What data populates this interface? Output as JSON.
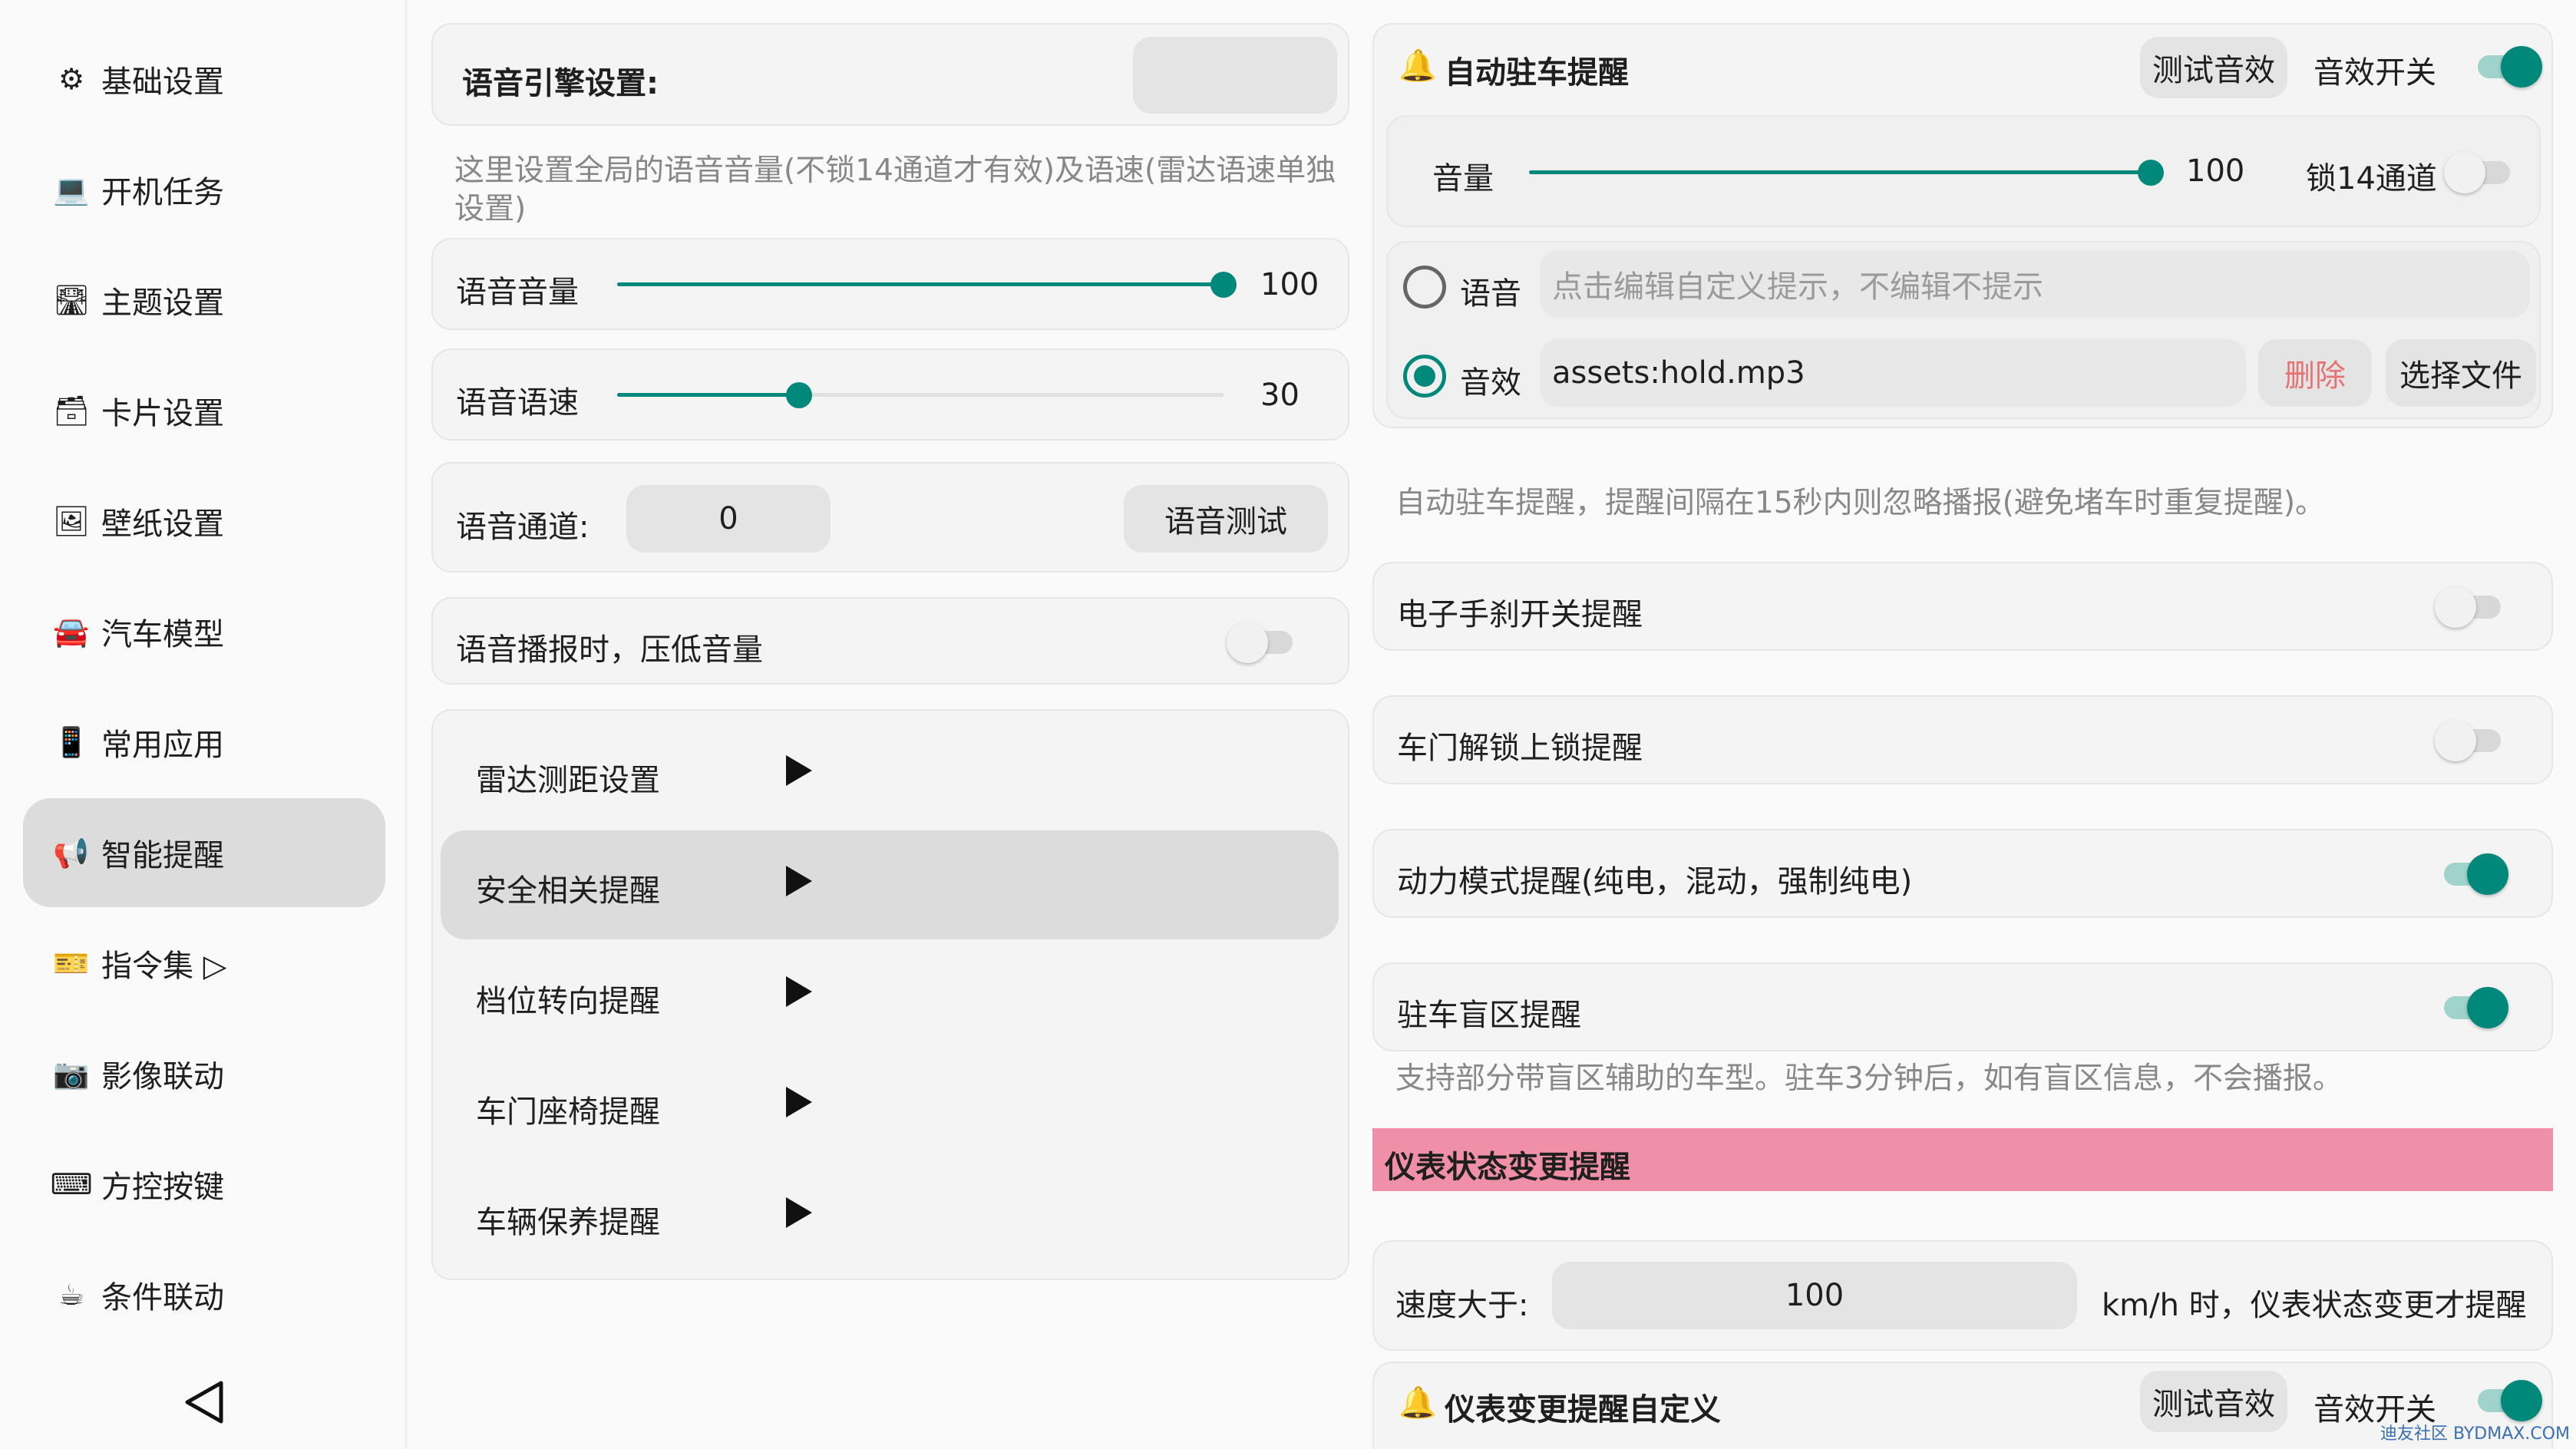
{
  "sidebar": {
    "items": [
      {
        "icon": "⚙",
        "label": "基础设置"
      },
      {
        "icon": "💻",
        "label": "开机任务"
      },
      {
        "icon": "🛣",
        "label": "主题设置"
      },
      {
        "icon": "🗃",
        "label": "卡片设置"
      },
      {
        "icon": "🖼",
        "label": "壁纸设置"
      },
      {
        "icon": "🚘",
        "label": "汽车模型"
      },
      {
        "icon": "📱",
        "label": "常用应用"
      },
      {
        "icon": "📢",
        "label": "智能提醒"
      },
      {
        "icon": "🎫",
        "label": "指令集 ▷"
      },
      {
        "icon": "📷",
        "label": "影像联动"
      },
      {
        "icon": "⌨",
        "label": "方控按键"
      },
      {
        "icon": "☕",
        "label": "条件联动"
      }
    ],
    "active_index": 7
  },
  "voice": {
    "engine_label": "语音引擎设置:",
    "desc": "这里设置全局的语音音量(不锁14通道才有效)及语速(雷达语速单独设置)",
    "volume_label": "语音音量",
    "volume_value": "100",
    "volume_level": 1.0,
    "speed_label": "语音语速",
    "speed_value": "30",
    "speed_level": 0.3,
    "channel_label": "语音通道:",
    "channel_value": "0",
    "test_label": "语音测试",
    "duck_label": "语音播报时，压低音量",
    "duck_on": false
  },
  "menu": {
    "items": [
      "雷达测距设置",
      "安全相关提醒",
      "档位转向提醒",
      "车门座椅提醒",
      "车辆保养提醒"
    ],
    "active_index": 1
  },
  "parking": {
    "title": "自动驻车提醒",
    "test_sound": "测试音效",
    "sound_switch_label": "音效开关",
    "sound_switch_on": true,
    "volume_label": "音量",
    "volume_value": "100",
    "volume_level": 1.0,
    "lock14_label": "锁14通道",
    "lock14_on": false,
    "voice_label": "语音",
    "voice_placeholder": "点击编辑自定义提示，不编辑不提示",
    "sound_label": "音效",
    "sound_file": "assets:hold.mp3",
    "delete_label": "删除",
    "choose_file_label": "选择文件",
    "desc": "自动驻车提醒，提醒间隔在15秒内则忽略播报(避免堵车时重复提醒)。"
  },
  "options": [
    {
      "label": "电子手刹开关提醒",
      "on": false
    },
    {
      "label": "车门解锁上锁提醒",
      "on": false
    },
    {
      "label": "动力模式提醒(纯电，混动，强制纯电)",
      "on": true
    },
    {
      "label": "驻车盲区提醒",
      "on": true
    }
  ],
  "blind_desc": "支持部分带盲区辅助的车型。驻车3分钟后，如有盲区信息，不会播报。",
  "dashboard": {
    "section_title": "仪表状态变更提醒",
    "speed_label": "速度大于:",
    "speed_value": "100",
    "speed_suffix": "km/h 时，仪表状态变更才提醒",
    "custom_title": "仪表变更提醒自定义",
    "test_sound": "测试音效",
    "sound_switch_label": "音效开关",
    "sound_switch_on": true
  },
  "watermark": "迪友社区 BYDMAX.COM",
  "colors": {
    "accent": "#00897b",
    "pink": "#f08fa8",
    "danger": "#e57373"
  }
}
